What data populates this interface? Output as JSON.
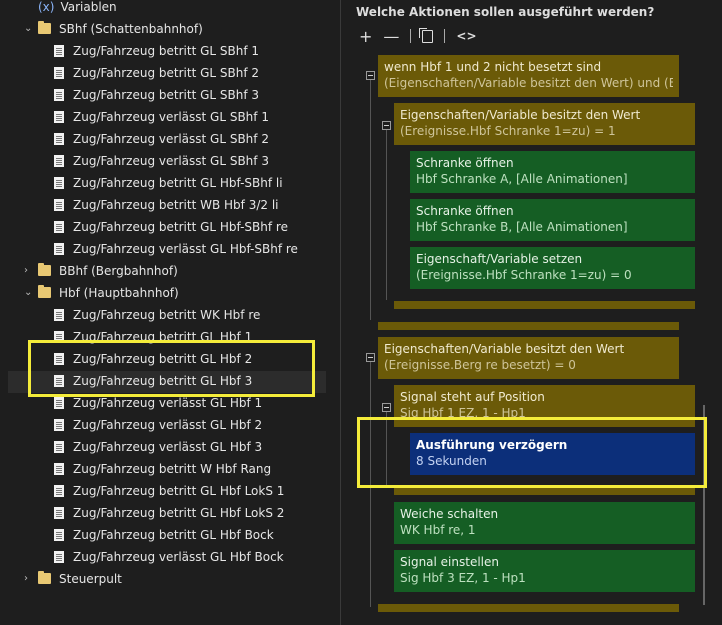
{
  "tree": {
    "variables_label": "Variablen",
    "variables_icon": "(x)",
    "items": [
      {
        "label": "SBhf (Schattenbahnhof)",
        "type": "folder",
        "expanded": true
      },
      {
        "label": "Zug/Fahrzeug betritt GL SBhf 1",
        "type": "doc"
      },
      {
        "label": "Zug/Fahrzeug betritt GL SBhf 2",
        "type": "doc"
      },
      {
        "label": "Zug/Fahrzeug betritt GL SBhf 3",
        "type": "doc"
      },
      {
        "label": "Zug/Fahrzeug verlässt GL SBhf 1",
        "type": "doc"
      },
      {
        "label": "Zug/Fahrzeug verlässt GL SBhf 2",
        "type": "doc"
      },
      {
        "label": "Zug/Fahrzeug verlässt GL SBhf 3",
        "type": "doc"
      },
      {
        "label": "Zug/Fahrzeug betritt GL Hbf-SBhf li",
        "type": "doc"
      },
      {
        "label": "Zug/Fahrzeug betritt WB Hbf 3/2 li",
        "type": "doc"
      },
      {
        "label": "Zug/Fahrzeug betritt GL Hbf-SBhf re",
        "type": "doc"
      },
      {
        "label": "Zug/Fahrzeug verlässt GL Hbf-SBhf re",
        "type": "doc"
      },
      {
        "label": "BBhf (Bergbahnhof)",
        "type": "folder",
        "expanded": false
      },
      {
        "label": "Hbf (Hauptbahnhof)",
        "type": "folder",
        "expanded": true
      },
      {
        "label": "Zug/Fahrzeug betritt WK Hbf re",
        "type": "doc"
      },
      {
        "label": "Zug/Fahrzeug betritt GL Hbf 1",
        "type": "doc"
      },
      {
        "label": "Zug/Fahrzeug betritt GL Hbf 2",
        "type": "doc"
      },
      {
        "label": "Zug/Fahrzeug betritt GL Hbf 3",
        "type": "doc",
        "selected": true
      },
      {
        "label": "Zug/Fahrzeug verlässt GL Hbf 1",
        "type": "doc"
      },
      {
        "label": "Zug/Fahrzeug verlässt GL Hbf 2",
        "type": "doc"
      },
      {
        "label": "Zug/Fahrzeug verlässt GL Hbf 3",
        "type": "doc"
      },
      {
        "label": "Zug/Fahrzeug betritt W Hbf Rang",
        "type": "doc"
      },
      {
        "label": "Zug/Fahrzeug betritt GL Hbf LokS 1",
        "type": "doc"
      },
      {
        "label": "Zug/Fahrzeug betritt GL Hbf LokS 2",
        "type": "doc"
      },
      {
        "label": "Zug/Fahrzeug betritt GL Hbf Bock",
        "type": "doc"
      },
      {
        "label": "Zug/Fahrzeug verlässt GL Hbf Bock",
        "type": "doc"
      },
      {
        "label": "Steuerpult",
        "type": "folder",
        "expanded": false
      }
    ]
  },
  "actions": {
    "title": "Welche Aktionen sollen ausgeführt werden?",
    "toolbar": {
      "add": "+",
      "remove": "—",
      "code": "<>",
      "copy_icon": "copy-icon"
    },
    "cards": {
      "if_hbf": {
        "title": "wenn Hbf 1 und 2 nicht besetzt sind",
        "detail": "(Eigenschaften/Variable besitzt den Wert) und (Eigens…"
      },
      "cond_schranke": {
        "title": "Eigenschaften/Variable besitzt den Wert",
        "detail": "(Ereignisse.Hbf Schranke 1=zu) = 1"
      },
      "open_a": {
        "title": "Schranke öffnen",
        "detail": "Hbf Schranke A, [Alle Animationen]"
      },
      "open_b": {
        "title": "Schranke öffnen",
        "detail": "Hbf Schranke B, [Alle Animationen]"
      },
      "set_var": {
        "title": "Eigenschaft/Variable setzen",
        "detail": "(Ereignisse.Hbf Schranke 1=zu) = 0"
      },
      "cond_berg": {
        "title": "Eigenschaften/Variable besitzt den Wert",
        "detail": "(Ereignisse.Berg re besetzt) = 0"
      },
      "signal_pos": {
        "title": "Signal steht auf Position",
        "detail": "Sig Hbf 1 EZ, 1 - Hp1"
      },
      "delay": {
        "title": "Ausführung verzögern",
        "detail": "8 Sekunden"
      },
      "switch": {
        "title": "Weiche schalten",
        "detail": "WK Hbf re, 1"
      },
      "signal_set": {
        "title": "Signal einstellen",
        "detail": "Sig Hbf 3 EZ, 1 - Hp1"
      }
    }
  },
  "colors": {
    "olive": "#6b5a08",
    "green": "#155e24",
    "blue": "#0c2f7a",
    "highlight": "#f4ec3a"
  }
}
